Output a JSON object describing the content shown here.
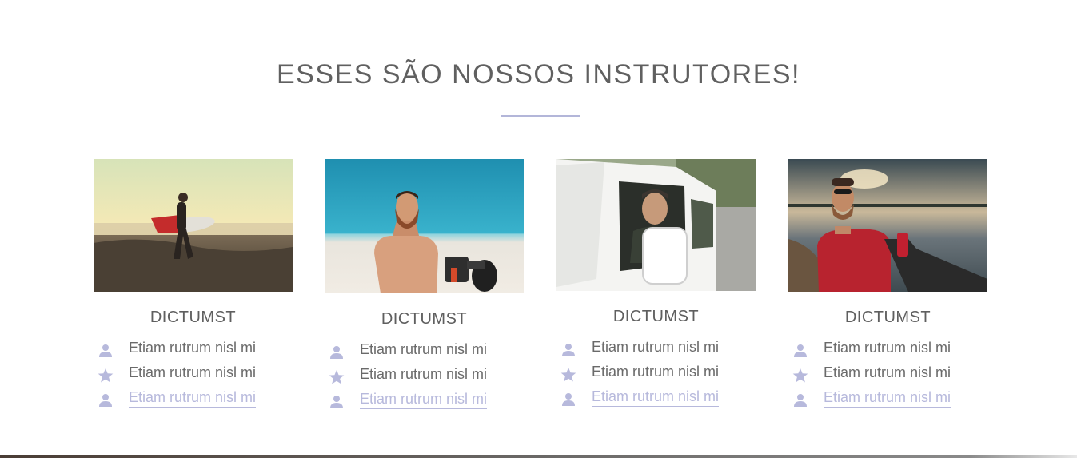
{
  "section": {
    "title": "ESSES SÃO NOSSOS INSTRUTORES!"
  },
  "colors": {
    "accent": "#b3b6d9",
    "icon": "#b7b9dc",
    "title_text": "#606060"
  },
  "instructors": [
    {
      "name": "DICTUMST",
      "photo": "surfer-on-beach-photo",
      "items": [
        {
          "icon": "user-icon",
          "text": "Etiam rutrum nisl mi"
        },
        {
          "icon": "star-icon",
          "text": "Etiam rutrum nisl mi"
        },
        {
          "icon": "user-icon",
          "text": "Etiam rutrum nisl mi",
          "link": true
        }
      ]
    },
    {
      "name": "DICTUMST",
      "photo": "bearded-man-with-camera-photo",
      "items": [
        {
          "icon": "user-icon",
          "text": "Etiam rutrum nisl mi"
        },
        {
          "icon": "star-icon",
          "text": "Etiam rutrum nisl mi"
        },
        {
          "icon": "user-icon",
          "text": "Etiam rutrum nisl mi",
          "link": true
        }
      ]
    },
    {
      "name": "DICTUMST",
      "photo": "man-in-van-photo",
      "items": [
        {
          "icon": "user-icon",
          "text": "Etiam rutrum nisl mi"
        },
        {
          "icon": "star-icon",
          "text": "Etiam rutrum nisl mi"
        },
        {
          "icon": "user-icon",
          "text": "Etiam rutrum nisl mi",
          "link": true
        }
      ]
    },
    {
      "name": "DICTUMST",
      "photo": "man-at-lake-sunset-photo",
      "items": [
        {
          "icon": "user-icon",
          "text": "Etiam rutrum nisl mi"
        },
        {
          "icon": "star-icon",
          "text": "Etiam rutrum nisl mi"
        },
        {
          "icon": "user-icon",
          "text": "Etiam rutrum nisl mi",
          "link": true
        }
      ]
    }
  ]
}
